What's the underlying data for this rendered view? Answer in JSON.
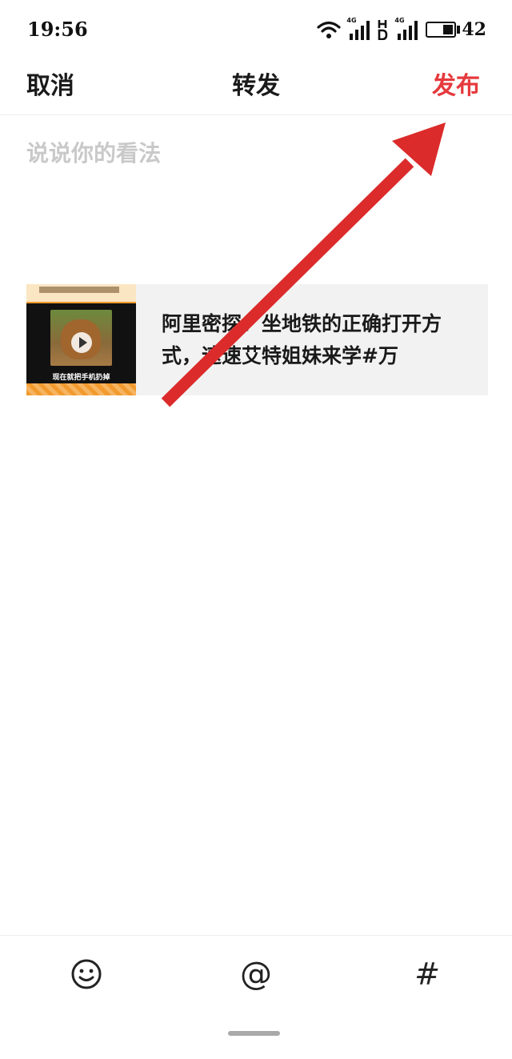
{
  "status_bar": {
    "time": "19:56",
    "network_1": "4G",
    "hd_label": "H",
    "network_2": "4G",
    "battery_level": "42",
    "battery_fraction": 0.42
  },
  "header": {
    "cancel_label": "取消",
    "title": "转发",
    "publish_label": "发布",
    "publish_color": "#e6393d"
  },
  "comment": {
    "placeholder": "说说你的看法",
    "value": ""
  },
  "shared_post": {
    "thumbnail_caption": "现在就把手机扔掉",
    "text": "阿里密探：坐地铁的正确打开方式，速速艾特姐妹来学#万"
  },
  "annotation": {
    "color": "#dc2b2b"
  },
  "toolbar": {
    "emoji_icon": "smiley-icon",
    "mention_label": "@",
    "hashtag_label": "#"
  }
}
